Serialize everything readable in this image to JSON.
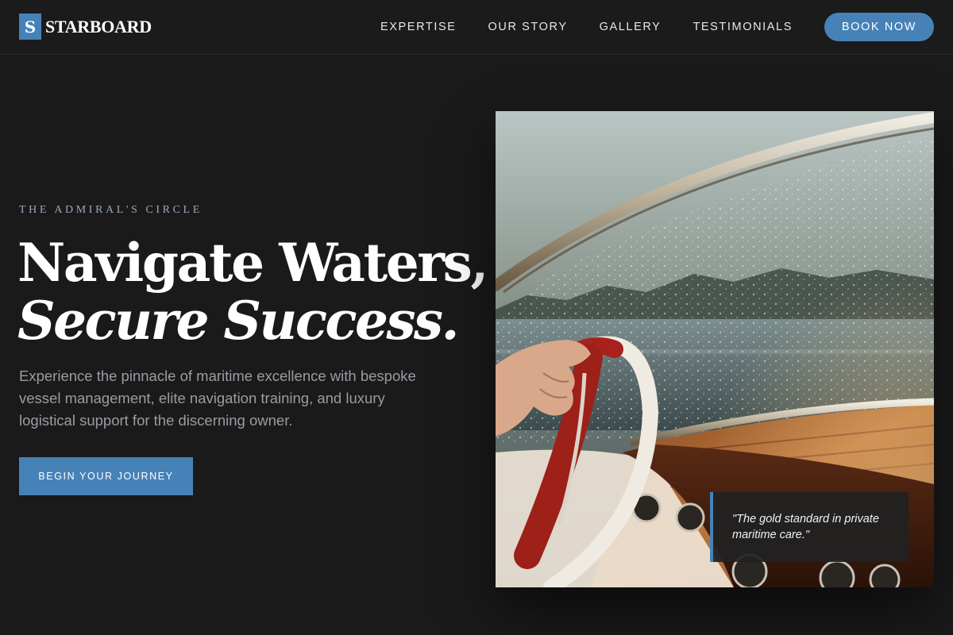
{
  "brand": {
    "mark": "S",
    "name": "STARBOARD",
    "accent": "#4682b8",
    "background": "#1a1a1b"
  },
  "nav": {
    "items": [
      {
        "label": "EXPERTISE"
      },
      {
        "label": "OUR STORY"
      },
      {
        "label": "GALLERY"
      },
      {
        "label": "TESTIMONIALS"
      }
    ],
    "cta_label": "BOOK NOW"
  },
  "hero": {
    "eyebrow": "THE ADMIRAL'S CIRCLE",
    "headline_line1": "Navigate Waters,",
    "headline_line2": "Secure Success.",
    "description": "Experience the pinnacle of maritime excellence with bespoke vessel management, elite navigation training, and luxury logistical support for the discerning owner.",
    "cta_label": "BEGIN YOUR JOURNEY",
    "image_subject": "boat-steering-wheel-photo",
    "quote": "\"The gold standard in private maritime care.\""
  }
}
